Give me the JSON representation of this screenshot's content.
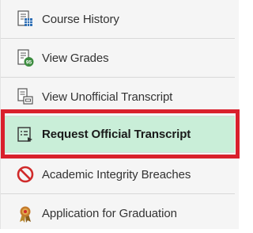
{
  "menu": {
    "items": [
      {
        "label": "Course History",
        "icon": "course-history-icon"
      },
      {
        "label": "View Grades",
        "icon": "view-grades-icon",
        "badge": "95"
      },
      {
        "label": "View Unofficial Transcript",
        "icon": "unofficial-transcript-icon"
      },
      {
        "label": "Request Official Transcript",
        "icon": "request-transcript-icon",
        "selected": true
      },
      {
        "label": "Academic Integrity Breaches",
        "icon": "prohibited-icon"
      },
      {
        "label": "Application for Graduation",
        "icon": "graduation-ribbon-icon"
      }
    ]
  },
  "colors": {
    "selected_background": "#c9eed8",
    "highlight_border": "#d9202c",
    "icon_blue": "#2f6fb5",
    "icon_green": "#3c8c3f"
  }
}
